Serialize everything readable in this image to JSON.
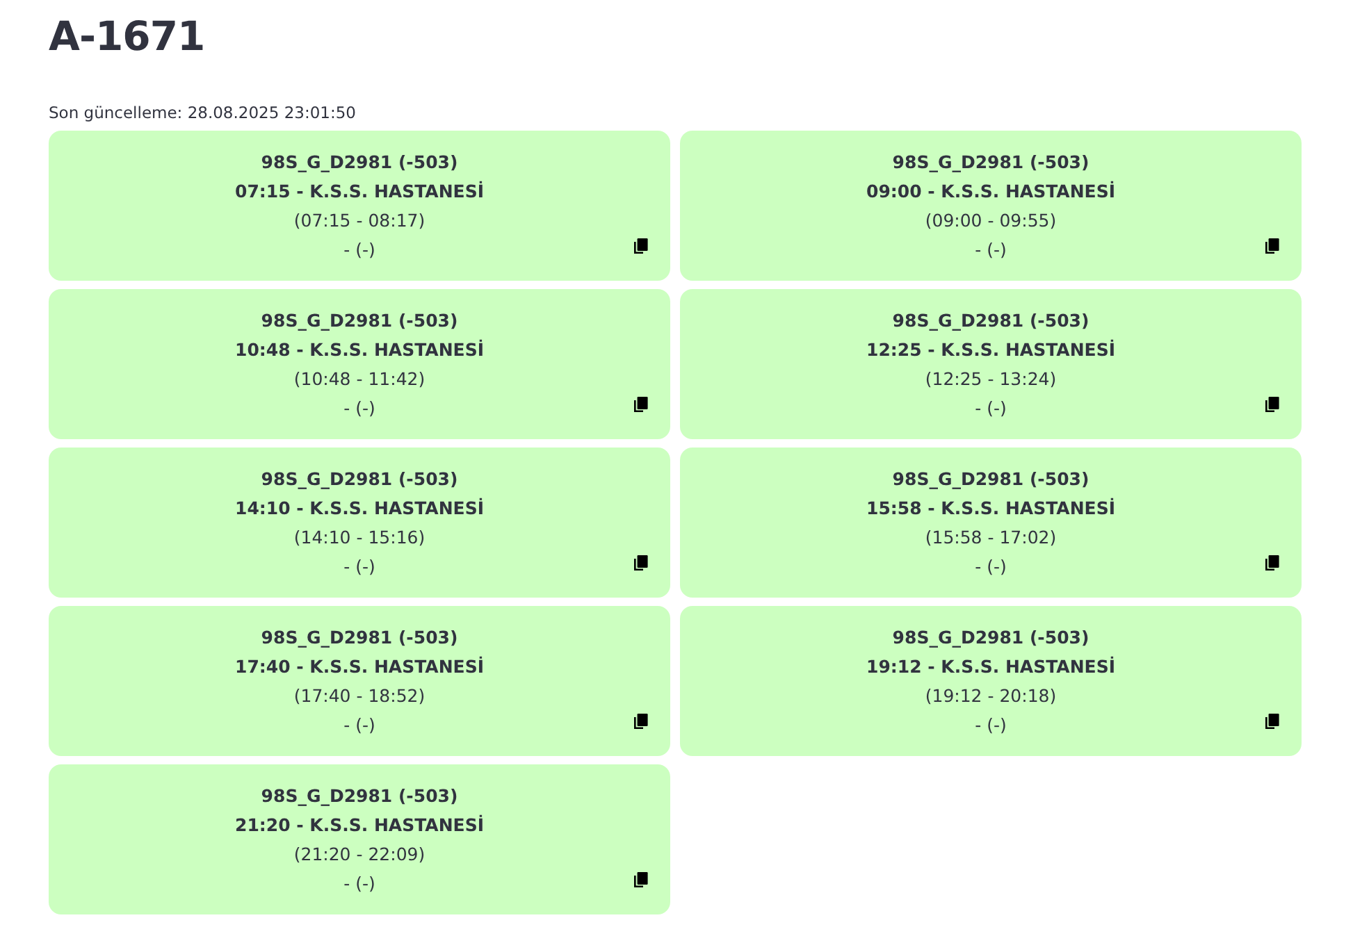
{
  "title": "A-1671",
  "last_updated": "Son güncelleme: 28.08.2025 23:01:50",
  "cards": [
    {
      "code": "98S_G_D2981 (-503)",
      "trip": "07:15 - K.S.S. HASTANESİ",
      "window": "(07:15 - 08:17)",
      "status": "- (-)"
    },
    {
      "code": "98S_G_D2981 (-503)",
      "trip": "09:00 - K.S.S. HASTANESİ",
      "window": "(09:00 - 09:55)",
      "status": "- (-)"
    },
    {
      "code": "98S_G_D2981 (-503)",
      "trip": "10:48 - K.S.S. HASTANESİ",
      "window": "(10:48 - 11:42)",
      "status": "- (-)"
    },
    {
      "code": "98S_G_D2981 (-503)",
      "trip": "12:25 - K.S.S. HASTANESİ",
      "window": "(12:25 - 13:24)",
      "status": "- (-)"
    },
    {
      "code": "98S_G_D2981 (-503)",
      "trip": "14:10 - K.S.S. HASTANESİ",
      "window": "(14:10 - 15:16)",
      "status": "- (-)"
    },
    {
      "code": "98S_G_D2981 (-503)",
      "trip": "15:58 - K.S.S. HASTANESİ",
      "window": "(15:58 - 17:02)",
      "status": "- (-)"
    },
    {
      "code": "98S_G_D2981 (-503)",
      "trip": "17:40 - K.S.S. HASTANESİ",
      "window": "(17:40 - 18:52)",
      "status": "- (-)"
    },
    {
      "code": "98S_G_D2981 (-503)",
      "trip": "19:12 - K.S.S. HASTANESİ",
      "window": "(19:12 - 20:18)",
      "status": "- (-)"
    },
    {
      "code": "98S_G_D2981 (-503)",
      "trip": "21:20 - K.S.S. HASTANESİ",
      "window": "(21:20 - 22:09)",
      "status": "- (-)"
    }
  ]
}
